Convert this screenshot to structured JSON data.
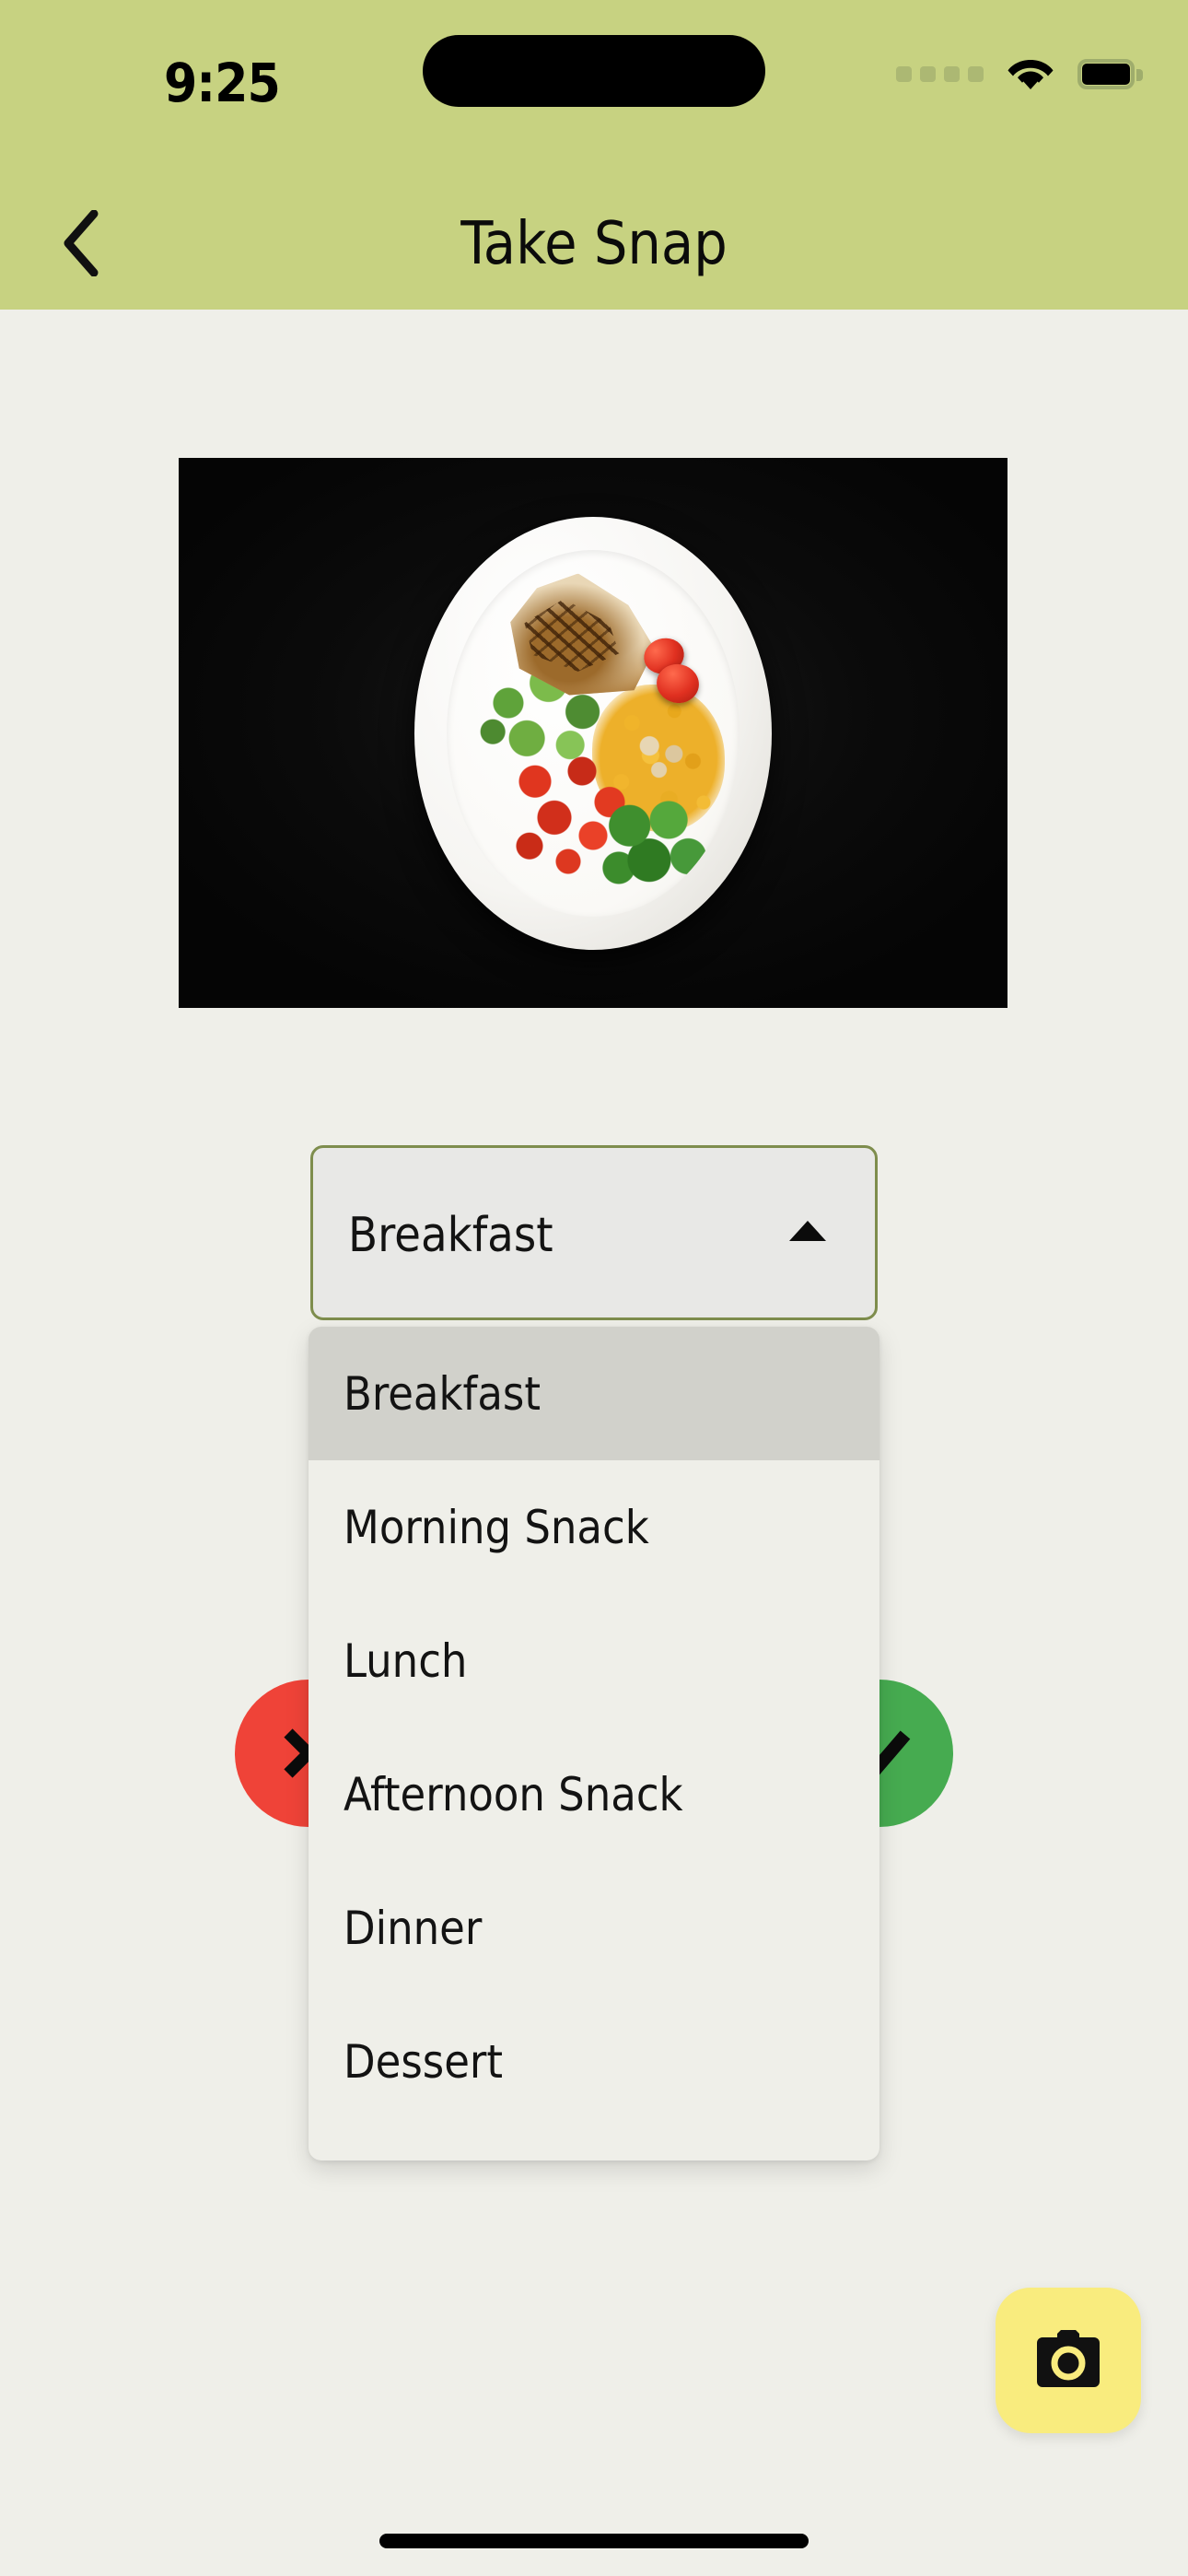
{
  "status_bar": {
    "time": "9:25",
    "signal_icon": "signal-dots-icon",
    "wifi_icon": "wifi-icon",
    "battery_icon": "battery-icon",
    "background_color": "#C7D281"
  },
  "header": {
    "title": "Take Snap",
    "back_icon": "chevron-left-icon",
    "background_color": "#C7D281"
  },
  "photo": {
    "alt": "Plated grilled chicken breast with salad greens, cherry tomatoes, yellow rice and broccoli on a white oval plate against a black background"
  },
  "meal_picker": {
    "selected_value": "Breakfast",
    "caret_icon": "triangle-up-icon",
    "border_color": "#7E8D4D",
    "field_background": "#E8E8E6",
    "options": [
      {
        "label": "Breakfast",
        "selected": true
      },
      {
        "label": "Morning Snack",
        "selected": false
      },
      {
        "label": "Lunch",
        "selected": false
      },
      {
        "label": "Afternoon Snack",
        "selected": false
      },
      {
        "label": "Dinner",
        "selected": false
      },
      {
        "label": "Dessert",
        "selected": false
      }
    ],
    "option_highlight_color": "#D1D1CB",
    "panel_background": "#EFEFE9"
  },
  "actions": {
    "cancel": {
      "icon": "close-x-icon",
      "color": "#EF4338"
    },
    "confirm": {
      "icon": "check-icon",
      "color": "#46AB50"
    }
  },
  "camera_button": {
    "icon": "camera-icon",
    "background_color": "#F9EC7E",
    "icon_color": "#111111"
  },
  "page": {
    "background_color": "#EFEFE9"
  }
}
